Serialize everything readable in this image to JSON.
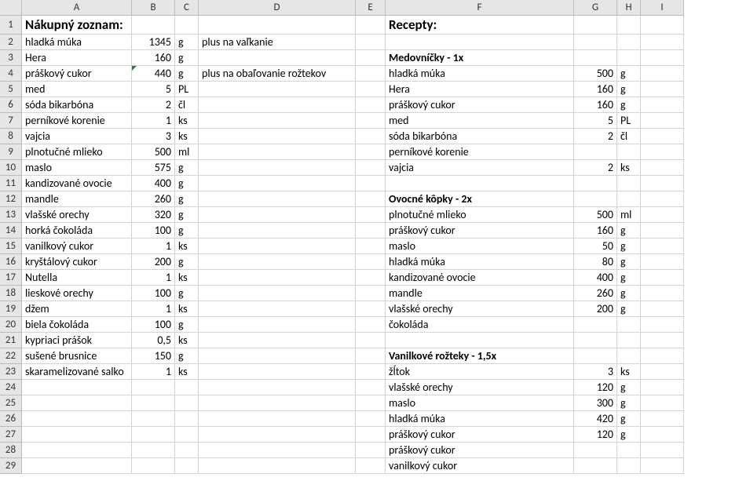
{
  "columns": [
    "A",
    "B",
    "C",
    "D",
    "E",
    "F",
    "G",
    "H",
    "I"
  ],
  "row_count": 29,
  "headers": {
    "A1": "Nákupný zoznam:",
    "F1": "Recepty:"
  },
  "shopping": [
    {
      "r": 2,
      "name": "hladká múka",
      "qty": "1345",
      "unit": "g",
      "note": "plus na vaľkanie"
    },
    {
      "r": 3,
      "name": "Hera",
      "qty": "160",
      "unit": "g"
    },
    {
      "r": 4,
      "name": "práškový cukor",
      "qty": "440",
      "unit": "g",
      "note": "plus na obaľovanie rožtekov",
      "tri": true
    },
    {
      "r": 5,
      "name": "med",
      "qty": "5",
      "unit": "PL"
    },
    {
      "r": 6,
      "name": "sóda bikarbóna",
      "qty": "2",
      "unit": "čl"
    },
    {
      "r": 7,
      "name": "perníkové korenie",
      "qty": "1",
      "unit": "ks"
    },
    {
      "r": 8,
      "name": "vajcia",
      "qty": "3",
      "unit": "ks"
    },
    {
      "r": 9,
      "name": "plnotučné mlieko",
      "qty": "500",
      "unit": "ml"
    },
    {
      "r": 10,
      "name": "maslo",
      "qty": "575",
      "unit": "g"
    },
    {
      "r": 11,
      "name": "kandizované ovocie",
      "qty": "400",
      "unit": "g"
    },
    {
      "r": 12,
      "name": "mandle",
      "qty": "260",
      "unit": "g"
    },
    {
      "r": 13,
      "name": "vlašské orechy",
      "qty": "320",
      "unit": "g"
    },
    {
      "r": 14,
      "name": "horká čokoláda",
      "qty": "100",
      "unit": "g"
    },
    {
      "r": 15,
      "name": "vanilkový cukor",
      "qty": "1",
      "unit": "ks"
    },
    {
      "r": 16,
      "name": "kryštálový cukor",
      "qty": "200",
      "unit": "g"
    },
    {
      "r": 17,
      "name": "Nutella",
      "qty": "1",
      "unit": "ks"
    },
    {
      "r": 18,
      "name": "lieskové orechy",
      "qty": "100",
      "unit": "g"
    },
    {
      "r": 19,
      "name": "džem",
      "qty": "1",
      "unit": "ks"
    },
    {
      "r": 20,
      "name": "biela čokoláda",
      "qty": "100",
      "unit": "g"
    },
    {
      "r": 21,
      "name": "kypriaci prášok",
      "qty": "0,5",
      "unit": "ks"
    },
    {
      "r": 22,
      "name": "sušené brusnice",
      "qty": "150",
      "unit": "g"
    },
    {
      "r": 23,
      "name": "skaramelizované salko",
      "qty": "1",
      "unit": "ks"
    }
  ],
  "recipes": [
    {
      "r": 3,
      "title": "Medovníčky - 1x"
    },
    {
      "r": 4,
      "name": "hladká múka",
      "qty": "500",
      "unit": "g"
    },
    {
      "r": 5,
      "name": "Hera",
      "qty": "160",
      "unit": "g"
    },
    {
      "r": 6,
      "name": "práškový cukor",
      "qty": "160",
      "unit": "g"
    },
    {
      "r": 7,
      "name": "med",
      "qty": "5",
      "unit": "PL"
    },
    {
      "r": 8,
      "name": "sóda bikarbóna",
      "qty": "2",
      "unit": "čl"
    },
    {
      "r": 9,
      "name": "perníkové korenie"
    },
    {
      "r": 10,
      "name": "vajcia",
      "qty": "2",
      "unit": "ks"
    },
    {
      "r": 12,
      "title": "Ovocné kôpky - 2x"
    },
    {
      "r": 13,
      "name": "plnotučné mlieko",
      "qty": "500",
      "unit": "ml"
    },
    {
      "r": 14,
      "name": "práškový cukor",
      "qty": "160",
      "unit": "g"
    },
    {
      "r": 15,
      "name": "maslo",
      "qty": "50",
      "unit": "g"
    },
    {
      "r": 16,
      "name": "hladká múka",
      "qty": "80",
      "unit": "g"
    },
    {
      "r": 17,
      "name": "kandizované ovocie",
      "qty": "400",
      "unit": "g"
    },
    {
      "r": 18,
      "name": "mandle",
      "qty": "260",
      "unit": "g"
    },
    {
      "r": 19,
      "name": "vlašské orechy",
      "qty": "200",
      "unit": "g"
    },
    {
      "r": 20,
      "name": "čokoláda"
    },
    {
      "r": 22,
      "title": "Vanilkové rožteky - 1,5x"
    },
    {
      "r": 23,
      "name": "žĺtok",
      "qty": "3",
      "unit": "ks"
    },
    {
      "r": 24,
      "name": "vlašské orechy",
      "qty": "120",
      "unit": "g"
    },
    {
      "r": 25,
      "name": "maslo",
      "qty": "300",
      "unit": "g"
    },
    {
      "r": 26,
      "name": "hladká múka",
      "qty": "420",
      "unit": "g"
    },
    {
      "r": 27,
      "name": "práškový cukor",
      "qty": "120",
      "unit": "g"
    },
    {
      "r": 28,
      "name": "práškový cukor"
    },
    {
      "r": 29,
      "name": "vanilkový cukor"
    }
  ]
}
